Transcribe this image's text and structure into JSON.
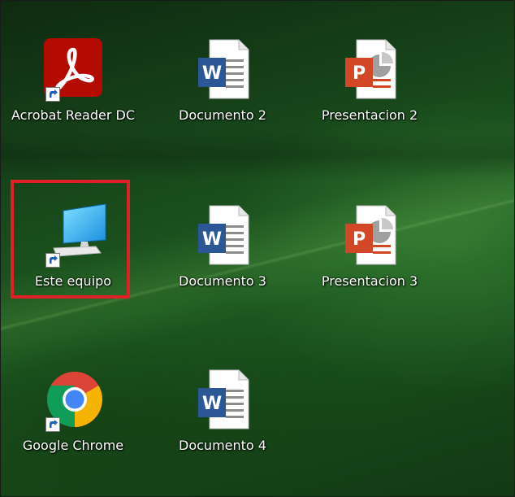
{
  "desktop": {
    "icons": [
      {
        "label": "Acrobat Reader DC",
        "type": "acrobat",
        "shortcut": true
      },
      {
        "label": "Documento 2",
        "type": "word",
        "shortcut": false
      },
      {
        "label": "Presentacion 2",
        "type": "powerpoint",
        "shortcut": false
      },
      {
        "label": "Este equipo",
        "type": "this-pc",
        "shortcut": true,
        "highlighted": true
      },
      {
        "label": "Documento 3",
        "type": "word",
        "shortcut": false
      },
      {
        "label": "Presentacion 3",
        "type": "powerpoint",
        "shortcut": false
      },
      {
        "label": "Google Chrome",
        "type": "chrome",
        "shortcut": true
      },
      {
        "label": "Documento 4",
        "type": "word",
        "shortcut": false
      }
    ],
    "highlight_color": "#e01f26"
  }
}
